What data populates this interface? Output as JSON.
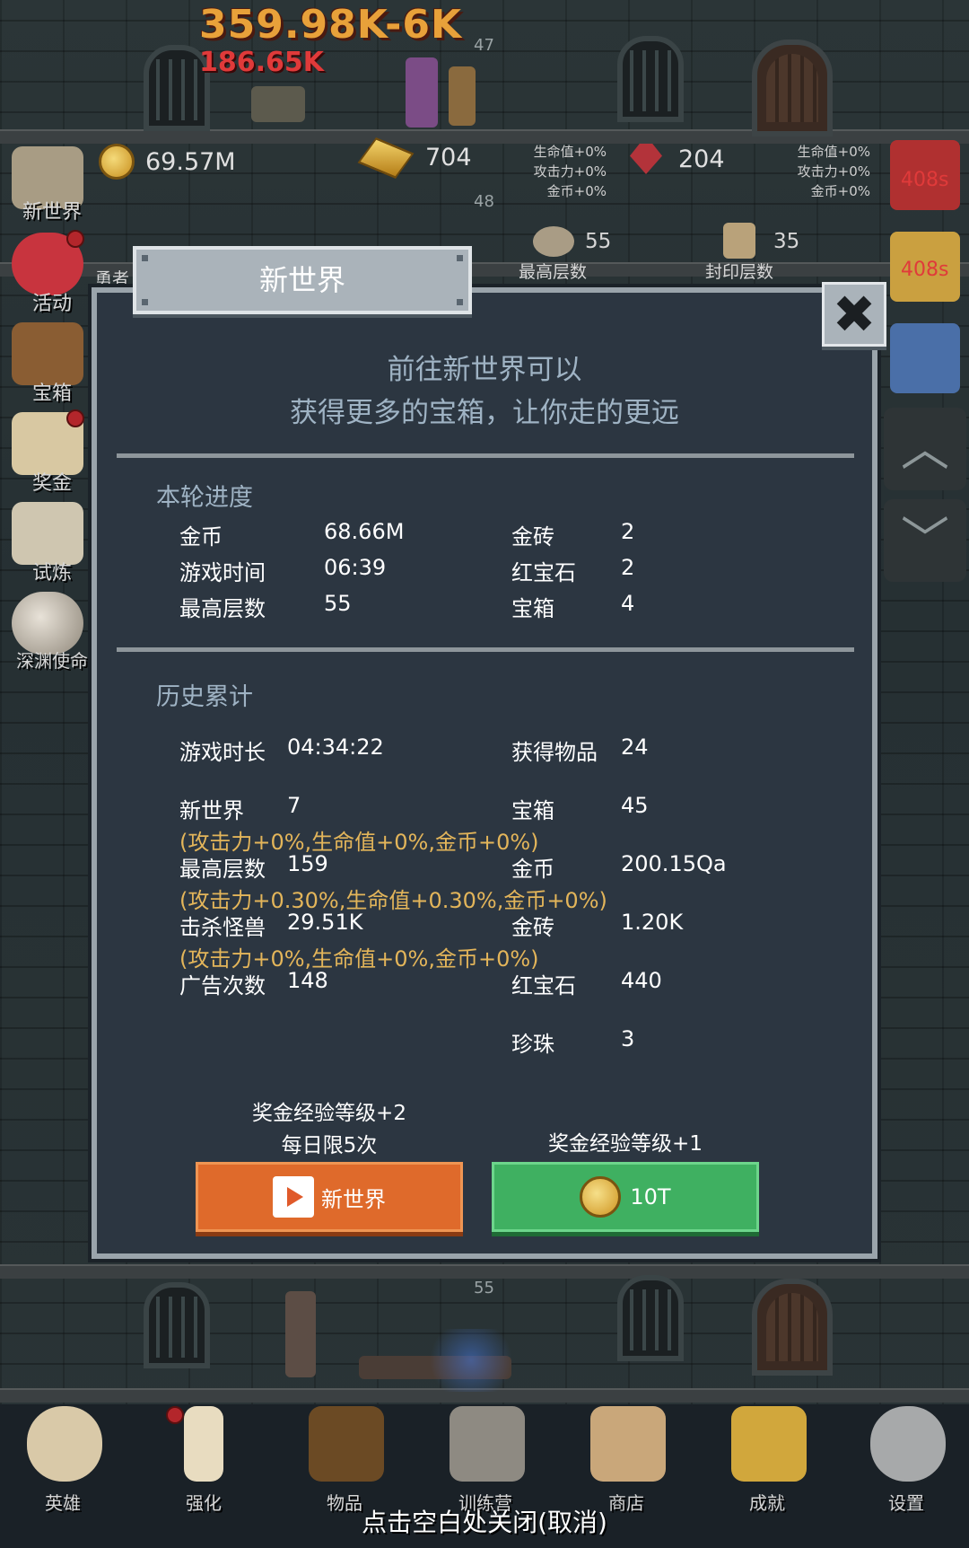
{
  "battle": {
    "damage_big": "359.98K-6K",
    "damage_small": "186.65K",
    "floor_top": "47",
    "floor_mid": "48",
    "floor_bottom": "55"
  },
  "resources": {
    "coins": "69.57M",
    "gold_bars": "704",
    "rubies": "204",
    "bonus_gold": [
      "生命值+0%",
      "攻击力+0%",
      "金币+0%"
    ],
    "bonus_ruby": [
      "生命值+0%",
      "攻击力+0%",
      "金币+0%"
    ],
    "highest_floor_value": "55",
    "highest_floor_label": "最高层数",
    "sealed_floor_value": "35",
    "sealed_floor_label": "封印层数",
    "hero_label": "勇者"
  },
  "side_menu": [
    "新世界",
    "活动",
    "宝箱",
    "奖金",
    "试炼",
    "深渊使命"
  ],
  "right_panel": {
    "timer_1": "408s",
    "timer_2": "408s"
  },
  "dialog": {
    "title": "新世界",
    "intro_line1": "前往新世界可以",
    "intro_line2": "获得更多的宝箱，让你走的更远",
    "round_section": "本轮进度",
    "round": {
      "coins_label": "金币",
      "coins": "68.66M",
      "time_label": "游戏时间",
      "time": "06:39",
      "floor_label": "最高层数",
      "floor": "55",
      "goldbar_label": "金砖",
      "goldbar": "2",
      "ruby_label": "红宝石",
      "ruby": "2",
      "chest_label": "宝箱",
      "chest": "4"
    },
    "history_section": "历史累计",
    "history": {
      "playtime_label": "游戏时长",
      "playtime": "04:34:22",
      "items_label": "获得物品",
      "items": "24",
      "newworld_label": "新世界",
      "newworld": "7",
      "newworld_note": "(攻击力+0%,生命值+0%,金币+0%)",
      "chest_label": "宝箱",
      "chest": "45",
      "maxfloor_label": "最高层数",
      "maxfloor": "159",
      "maxfloor_note": "(攻击力+0.30%,生命值+0.30%,金币+0%)",
      "coins_label": "金币",
      "coins": "200.15Qa",
      "kills_label": "击杀怪兽",
      "kills": "29.51K",
      "kills_note": "(攻击力+0%,生命值+0%,金币+0%)",
      "goldbar_label": "金砖",
      "goldbar": "1.20K",
      "ads_label": "广告次数",
      "ads": "148",
      "ruby_label": "红宝石",
      "ruby": "440",
      "pearl_label": "珍珠",
      "pearl": "3"
    },
    "caption_ad_line1": "奖金经验等级+2",
    "caption_ad_line2": "每日限5次",
    "caption_coin": "奖金经验等级+1",
    "btn_ad_label": "新世界",
    "btn_coin_label": "10T",
    "close_icon": "✖"
  },
  "bottom_nav": [
    "英雄",
    "强化",
    "物品",
    "训练营",
    "商店",
    "成就",
    "设置"
  ],
  "close_hint": "点击空白处关闭(取消)",
  "colors": {
    "dialog_bg": "#2c3641",
    "accent_orange": "#df6a2b",
    "accent_green": "#3fb061",
    "note_gold": "#e3b55a"
  }
}
